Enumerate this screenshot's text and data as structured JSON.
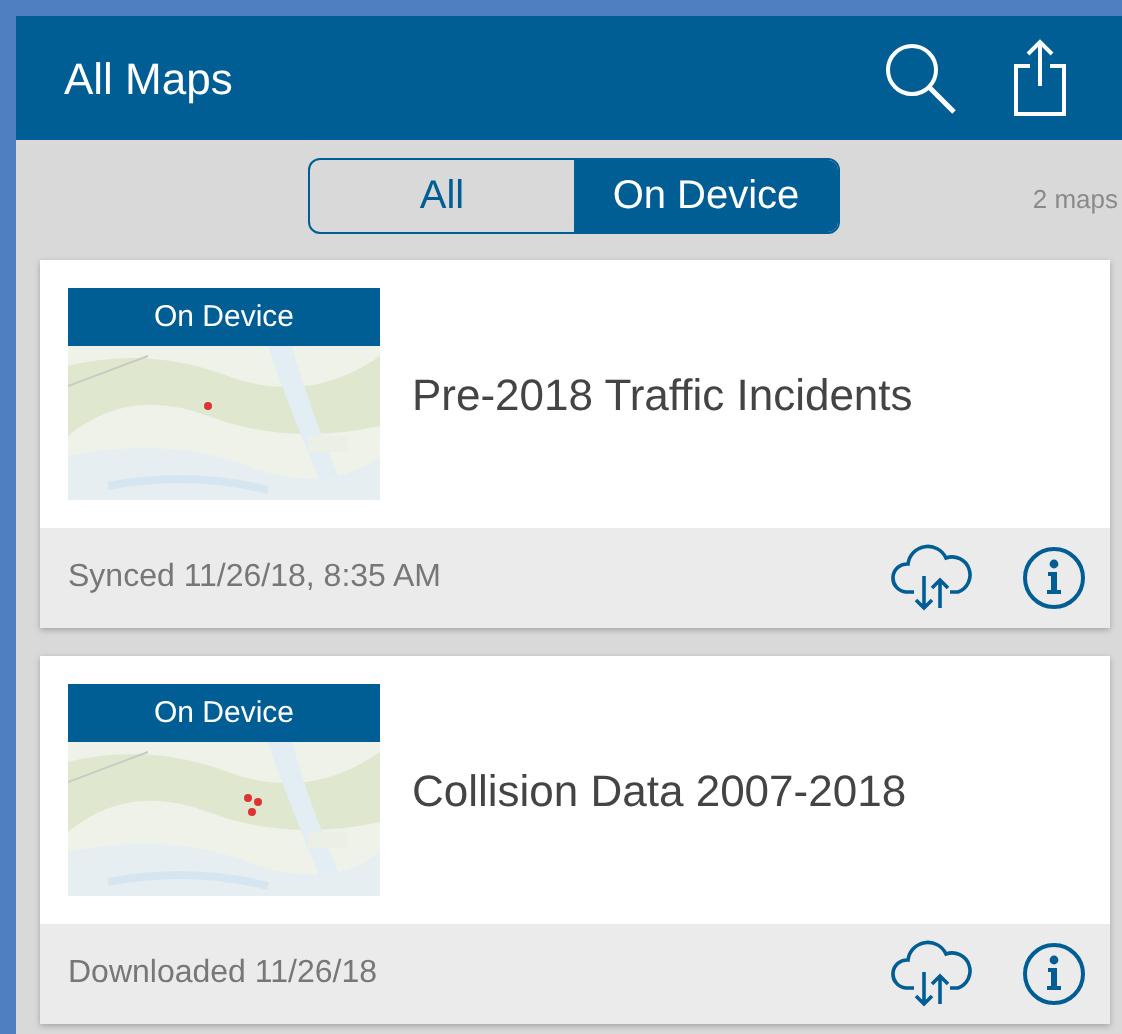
{
  "header": {
    "title": "All Maps"
  },
  "filter": {
    "segments": [
      {
        "label": "All",
        "selected": false
      },
      {
        "label": "On Device",
        "selected": true
      }
    ],
    "count": "2 maps"
  },
  "maps": [
    {
      "badge": "On Device",
      "title": "Pre-2018 Traffic Incidents",
      "status": "Synced 11/26/18, 8:35 AM"
    },
    {
      "badge": "On Device",
      "title": "Collision Data 2007-2018",
      "status": "Downloaded 11/26/18"
    }
  ]
}
